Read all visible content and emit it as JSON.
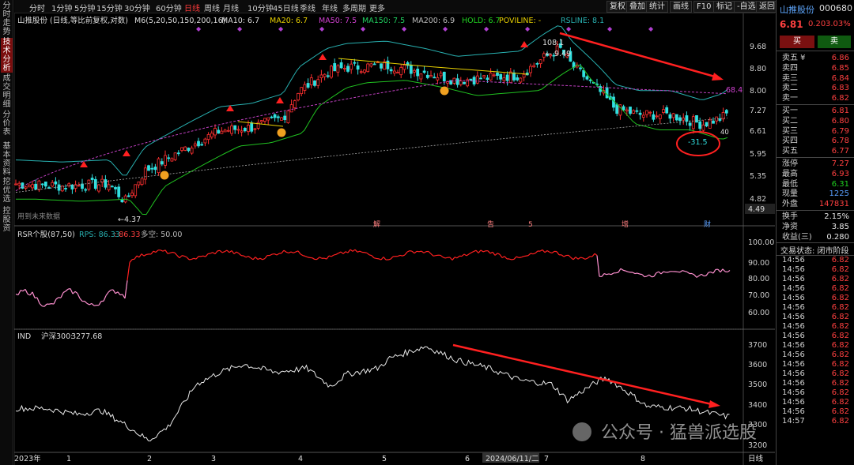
{
  "left_nav": [
    {
      "label": "分时走势",
      "active": false
    },
    {
      "label": "技术分析",
      "active": true
    },
    {
      "label": "成交明细",
      "active": false
    },
    {
      "label": "分价表",
      "active": false
    },
    {
      "label": "基本资料",
      "active": false
    },
    {
      "label": "挖优选",
      "active": false
    },
    {
      "label": "控股资",
      "active": false
    }
  ],
  "toolbar": {
    "periods": [
      "分时",
      "1分钟",
      "5分钟",
      "15分钟",
      "30分钟",
      "60分钟",
      "日线",
      "周线",
      "月线",
      "10分钟",
      "45日线",
      "季线",
      "年线",
      "多周期",
      "更多"
    ],
    "active_period": "日线",
    "right_buttons": [
      "复权",
      "叠加",
      "统计",
      "画线",
      "F10",
      "标记",
      "-自选",
      "返回"
    ]
  },
  "main_header": {
    "stock": "山推股份 (日线,等比前复权,对数)",
    "ma_label": "M6(5,20,50,150,200,16)",
    "ma10": "MA10: 6.7",
    "ma20": "MA20: 6.7",
    "ma50": "MA50: 7.5",
    "ma150": "MA150: 7.5",
    "ma200": "MA200: 6.9",
    "hold": "HOLD: 6.7",
    "poviline": "POVILINE: -",
    "rsline": "RSLINE: 8.1"
  },
  "main_axis": [
    "9.68",
    "8.80",
    "8.00",
    "7.27",
    "6.61",
    "5.95",
    "5.35",
    "4.82"
  ],
  "price_box": "4.49",
  "annotations": {
    "high": "108.1",
    "high_price": "9.49",
    "low_price": "4.37",
    "rs_value": "68.4",
    "rs_drop": "-31.5",
    "ma_val": "40",
    "future": "用到未来数据"
  },
  "event_markers": [
    "解",
    "告",
    "5",
    "增",
    "财"
  ],
  "rsr": {
    "title": "RSR个股(87,50)",
    "rps": "RPS: 86.33",
    "val": ": 86.33",
    "flat": "多空: 50.00",
    "axis": [
      "100.00",
      "90.00",
      "80.00",
      "70.00",
      "60.00"
    ]
  },
  "ind": {
    "title": "IND",
    "name": "沪深300:",
    "val": "3277.68",
    "axis": [
      "3700",
      "3600",
      "3500",
      "3400",
      "3300",
      "3200"
    ]
  },
  "bottom_axis": {
    "labels": [
      "2023年",
      "1",
      "2",
      "3",
      "4",
      "5",
      "6",
      "2024/06/11/二",
      "7",
      "8"
    ],
    "right": "日线"
  },
  "watermark": "公众号 · 猛兽派选股",
  "panel": {
    "name": "山推股份",
    "code": "000680",
    "price": "6.81",
    "change": "0.20",
    "pct": "3.03%",
    "buy_btn": "买",
    "sell_btn": "卖",
    "asks": [
      {
        "k": "卖五",
        "flag": "¥",
        "v": "6.86",
        "n": "",
        "c": "red"
      },
      {
        "k": "卖四",
        "v": "6.85",
        "c": "red"
      },
      {
        "k": "卖三",
        "v": "6.84",
        "c": "red"
      },
      {
        "k": "卖二",
        "v": "6.83",
        "c": "red"
      },
      {
        "k": "卖一",
        "v": "6.82",
        "c": "red"
      }
    ],
    "bids": [
      {
        "k": "买一",
        "v": "6.81",
        "c": "red"
      },
      {
        "k": "买二",
        "v": "6.80",
        "c": "red"
      },
      {
        "k": "买三",
        "v": "6.79",
        "c": "red"
      },
      {
        "k": "买四",
        "v": "6.78",
        "c": "red"
      },
      {
        "k": "买五",
        "v": "6.77",
        "c": "red"
      }
    ],
    "stats1": [
      {
        "k": "涨停",
        "v": "7.27",
        "c": "red"
      },
      {
        "k": "最高",
        "v": "6.93",
        "c": "red"
      },
      {
        "k": "最低",
        "v": "6.31",
        "c": "green"
      },
      {
        "k": "现量",
        "v": "1225",
        "c": "blue"
      },
      {
        "k": "外盘",
        "v": "147831",
        "c": "red"
      }
    ],
    "stats2": [
      {
        "k": "换手",
        "v": "2.15%",
        "c": "white"
      },
      {
        "k": "净资",
        "v": "3.85",
        "c": "white"
      },
      {
        "k": "收益(三)",
        "v": "0.280",
        "c": "white"
      }
    ],
    "status": "交易状态: 闭市阶段",
    "ticks": [
      {
        "t": "14:56",
        "v": "6.82"
      },
      {
        "t": "14:56",
        "v": "6.82"
      },
      {
        "t": "14:56",
        "v": "6.82"
      },
      {
        "t": "14:56",
        "v": "6.82"
      },
      {
        "t": "14:56",
        "v": "6.82"
      },
      {
        "t": "14:56",
        "v": "6.82"
      },
      {
        "t": "14:56",
        "v": "6.82"
      },
      {
        "t": "14:56",
        "v": "6.82"
      },
      {
        "t": "14:56",
        "v": "6.82"
      },
      {
        "t": "14:56",
        "v": "6.82"
      },
      {
        "t": "14:56",
        "v": "6.82"
      },
      {
        "t": "14:56",
        "v": "6.82"
      },
      {
        "t": "14:56",
        "v": "6.82"
      },
      {
        "t": "14:56",
        "v": "6.82"
      },
      {
        "t": "14:56",
        "v": "6.82"
      },
      {
        "t": "14:56",
        "v": "6.82"
      },
      {
        "t": "14:56",
        "v": "6.82"
      },
      {
        "t": "14:57",
        "v": "6.82"
      }
    ]
  },
  "chart_data": {
    "type": "candlestick",
    "title": "山推股份 (日线,等比前复权,对数)",
    "price_range": [
      4.37,
      9.49
    ],
    "y_ticks": [
      9.68,
      8.8,
      8.0,
      7.27,
      6.61,
      5.95,
      5.35,
      4.82
    ],
    "month_labels": [
      "2023年",
      "1",
      "2",
      "3",
      "4",
      "5",
      "6",
      "7",
      "8"
    ],
    "close_path_by_month": [
      4.9,
      4.8,
      5.6,
      6.7,
      8.3,
      8.5,
      8.0,
      8.6,
      6.8,
      6.7
    ],
    "rsr_range": [
      60,
      100
    ],
    "ind_range": [
      3200,
      3700
    ]
  }
}
